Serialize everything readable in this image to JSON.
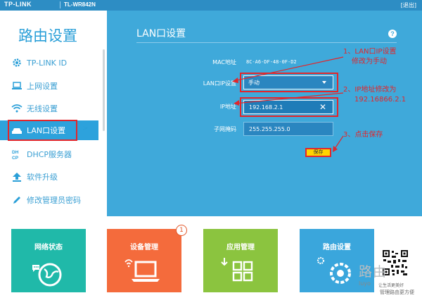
{
  "topbar": {
    "brand": "TP-LINK",
    "model": "TL-WR842N",
    "exit": "[退出]"
  },
  "sidebar": {
    "title": "路由设置",
    "items": [
      {
        "label": "TP-LINK ID",
        "icon": "gear-icon"
      },
      {
        "label": "上网设置",
        "icon": "laptop-icon"
      },
      {
        "label": "无线设置",
        "icon": "wifi-icon"
      },
      {
        "label": "LAN口设置",
        "icon": "router-icon",
        "active": true,
        "arrow": ">"
      },
      {
        "label": "DHCP服务器",
        "icon": "dhcp-icon"
      },
      {
        "label": "软件升级",
        "icon": "upload-icon"
      },
      {
        "label": "修改管理员密码",
        "icon": "pencil-icon"
      }
    ]
  },
  "main": {
    "title": "LAN口设置",
    "help": "?",
    "mac": {
      "label": "MAC地址",
      "value": "8C-A6-DF-48-0F-D2"
    },
    "lan_type": {
      "label": "LAN口IP设置",
      "value": "手动"
    },
    "ip": {
      "label": "IP地址",
      "value": "192.168.2.1"
    },
    "mask": {
      "label": "子网掩码",
      "value": "255.255.255.0"
    },
    "save_label": "保存"
  },
  "annotations": {
    "step1_line1": "1、LAN口IP设置",
    "step1_line2": "修改为手动",
    "step2_line1": "2、IP地址修改为",
    "step2_line2": "192.16866.2.1",
    "step3": "3、点击保存"
  },
  "tiles": [
    {
      "label": "网络状态",
      "color": "#20b9a9"
    },
    {
      "label": "设备管理",
      "color": "#f46b3c",
      "badge": "1"
    },
    {
      "label": "应用管理",
      "color": "#8bc43f"
    },
    {
      "label": "路由设置",
      "color": "#3aa6dc"
    }
  ],
  "watermark": {
    "brand": "路由",
    "url": "luyo",
    "tag": "让生活更美好",
    "sub": "管理路由更方便"
  }
}
